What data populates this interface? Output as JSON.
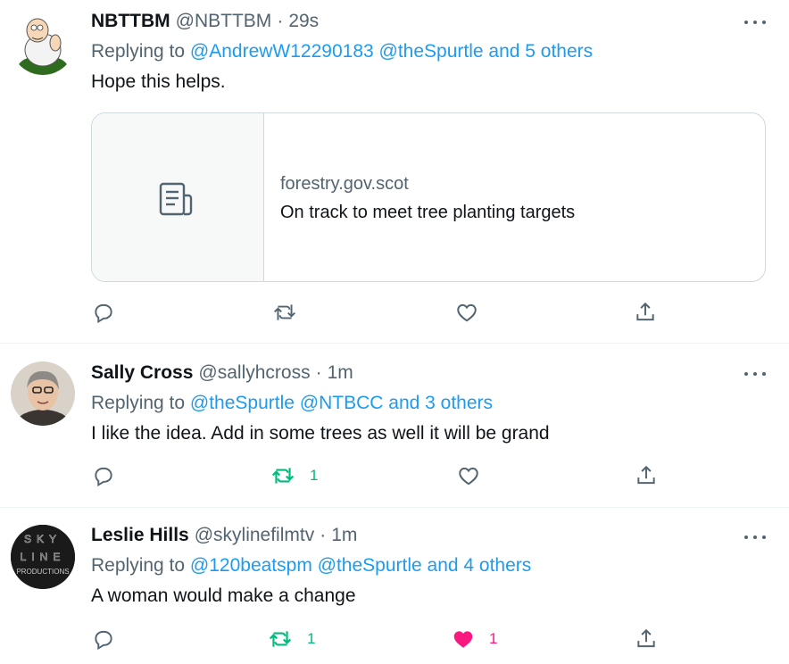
{
  "colors": {
    "link": "#1d9bf0",
    "secondary": "#536471",
    "retweet": "#00ba7c",
    "like": "#f91880"
  },
  "tweets": [
    {
      "name": "NBTTBM",
      "handle": "@NBTTBM",
      "dot": "·",
      "time": "29s",
      "replying_prefix": "Replying to",
      "replying_links": "@AndrewW12290183 @theSpurtle and 5 others",
      "text": "Hope this helps.",
      "card": {
        "domain": "forestry.gov.scot",
        "title": "On track to meet tree planting targets",
        "icon": "article-icon"
      },
      "retweets": "",
      "likes": ""
    },
    {
      "name": "Sally Cross",
      "handle": "@sallyhcross",
      "dot": "·",
      "time": "1m",
      "replying_prefix": "Replying to",
      "replying_links": "@theSpurtle @NTBCC and 3 others",
      "text": "I like the idea. Add in some trees as well it will  be grand",
      "retweets": "1",
      "likes": ""
    },
    {
      "name": "Leslie Hills",
      "handle": "@skylinefilmtv",
      "dot": "·",
      "time": "1m",
      "replying_prefix": "Replying to",
      "replying_links": "@120beatspm @theSpurtle and 4 others",
      "text": "A woman would make a change",
      "avatar_text": {
        "line1": "SKY",
        "line2": "LINE",
        "line3": "PRODUCTIONS"
      },
      "retweets": "1",
      "likes": "1"
    }
  ]
}
